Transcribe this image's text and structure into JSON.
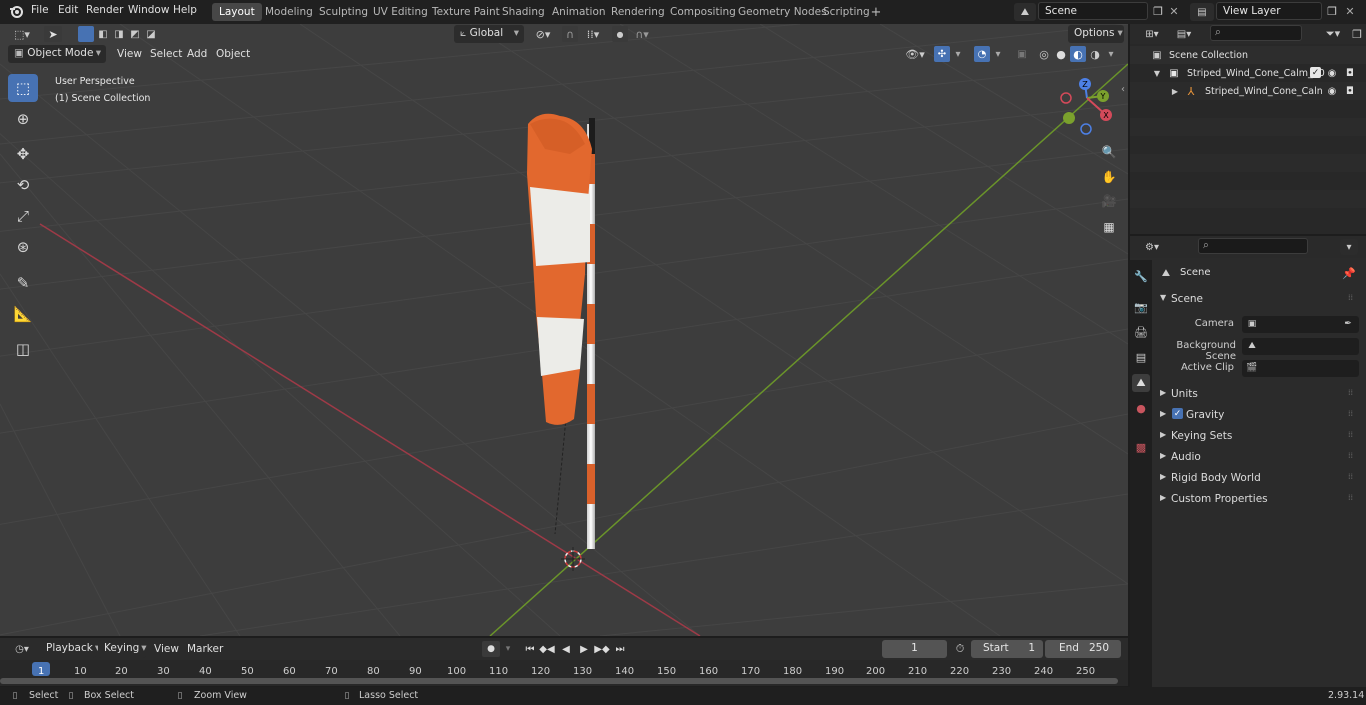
{
  "top_menu": [
    "File",
    "Edit",
    "Render",
    "Window",
    "Help"
  ],
  "workspace_tabs": [
    "Layout",
    "Modeling",
    "Sculpting",
    "UV Editing",
    "Texture Paint",
    "Shading",
    "Animation",
    "Rendering",
    "Compositing",
    "Geometry Nodes",
    "Scripting"
  ],
  "active_workspace": "Layout",
  "scene_name": "Scene",
  "view_layer_name": "View Layer",
  "viewport": {
    "orientation": "Global",
    "options_label": "Options",
    "mode": "Object Mode",
    "menu": [
      "View",
      "Select",
      "Add",
      "Object"
    ],
    "perspective_label": "User Perspective",
    "collection_label": "(1) Scene Collection"
  },
  "gizmo": {
    "x": "X",
    "y": "Y",
    "z": "Z"
  },
  "outliner": {
    "root": "Scene Collection",
    "items": [
      {
        "label": "Striped_Wind_Cone_Calm_00"
      },
      {
        "label": "Striped_Wind_Cone_Caln"
      }
    ]
  },
  "properties": {
    "context": "Scene",
    "section_title": "Scene",
    "fields": [
      {
        "label": "Camera"
      },
      {
        "label": "Background Scene"
      },
      {
        "label": "Active Clip"
      }
    ],
    "panels": [
      "Units",
      "Gravity",
      "Keying Sets",
      "Audio",
      "Rigid Body World",
      "Custom Properties"
    ]
  },
  "timeline": {
    "menu": [
      "Playback",
      "Keying",
      "View",
      "Marker"
    ],
    "current_frame": "1",
    "start_label": "Start",
    "start_value": "1",
    "end_label": "End",
    "end_value": "250",
    "ruler": [
      "1",
      "10",
      "20",
      "30",
      "40",
      "50",
      "60",
      "70",
      "80",
      "90",
      "100",
      "110",
      "120",
      "130",
      "140",
      "150",
      "160",
      "170",
      "180",
      "190",
      "200",
      "210",
      "220",
      "230",
      "240",
      "250"
    ]
  },
  "status": {
    "select": "Select",
    "box_select": "Box Select",
    "zoom_view": "Zoom View",
    "lasso_select": "Lasso Select",
    "version": "2.93.14"
  },
  "colors": {
    "accent": "#4772b3",
    "x_axis": "#c1404f",
    "y_axis": "#7ba12d",
    "cone_orange": "#e2682e"
  }
}
